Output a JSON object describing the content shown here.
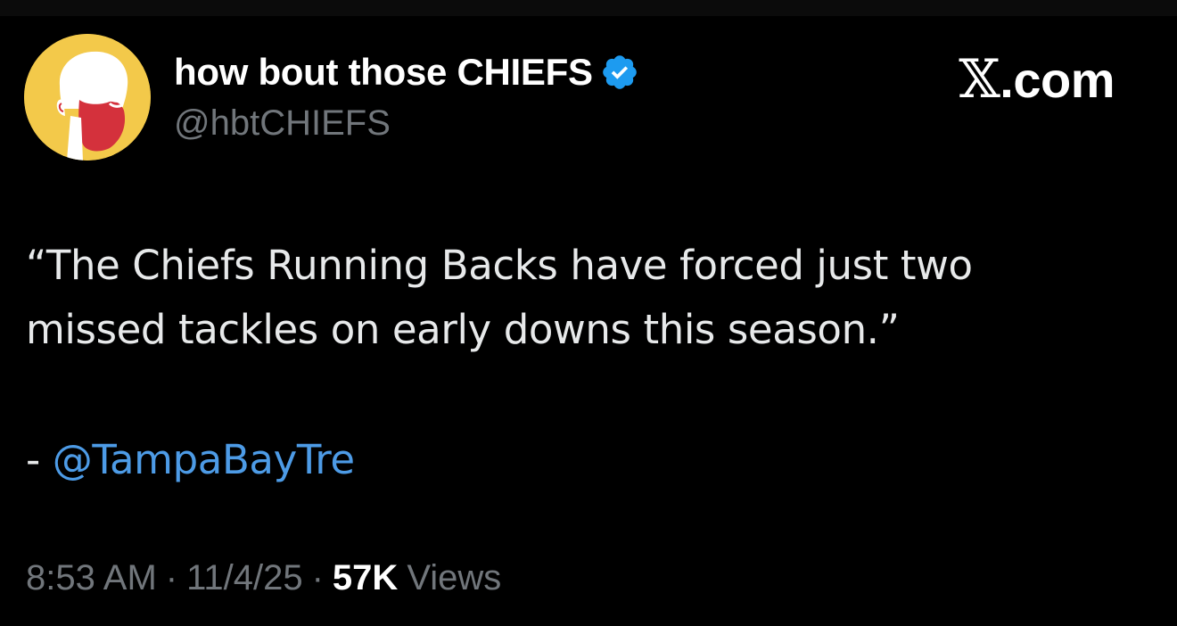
{
  "author": {
    "display_name": "how bout those CHIEFS",
    "handle": "@hbtCHIEFS",
    "verified": true,
    "avatar": {
      "icon": "bearded-man-avatar",
      "bg_color": "#f3c94a",
      "beard_color": "#d4313c",
      "face_color": "#ffffff"
    }
  },
  "brand": {
    "glyph": "𝕏",
    "suffix": ".com"
  },
  "tweet": {
    "lines": [
      "“The Chiefs Running Backs have forced just two",
      "missed tackles on early downs this season.”"
    ],
    "credit_prefix": "- ",
    "credit_mention": "@TampaBayTre"
  },
  "meta": {
    "time": "8:53 AM",
    "separator": "·",
    "date": "11/4/25",
    "views_count": "57K",
    "views_label": "Views"
  },
  "colors": {
    "background": "#000000",
    "text": "#e7e9ea",
    "muted": "#71767b",
    "link": "#4d9be6",
    "verified": "#1d9bf0"
  }
}
